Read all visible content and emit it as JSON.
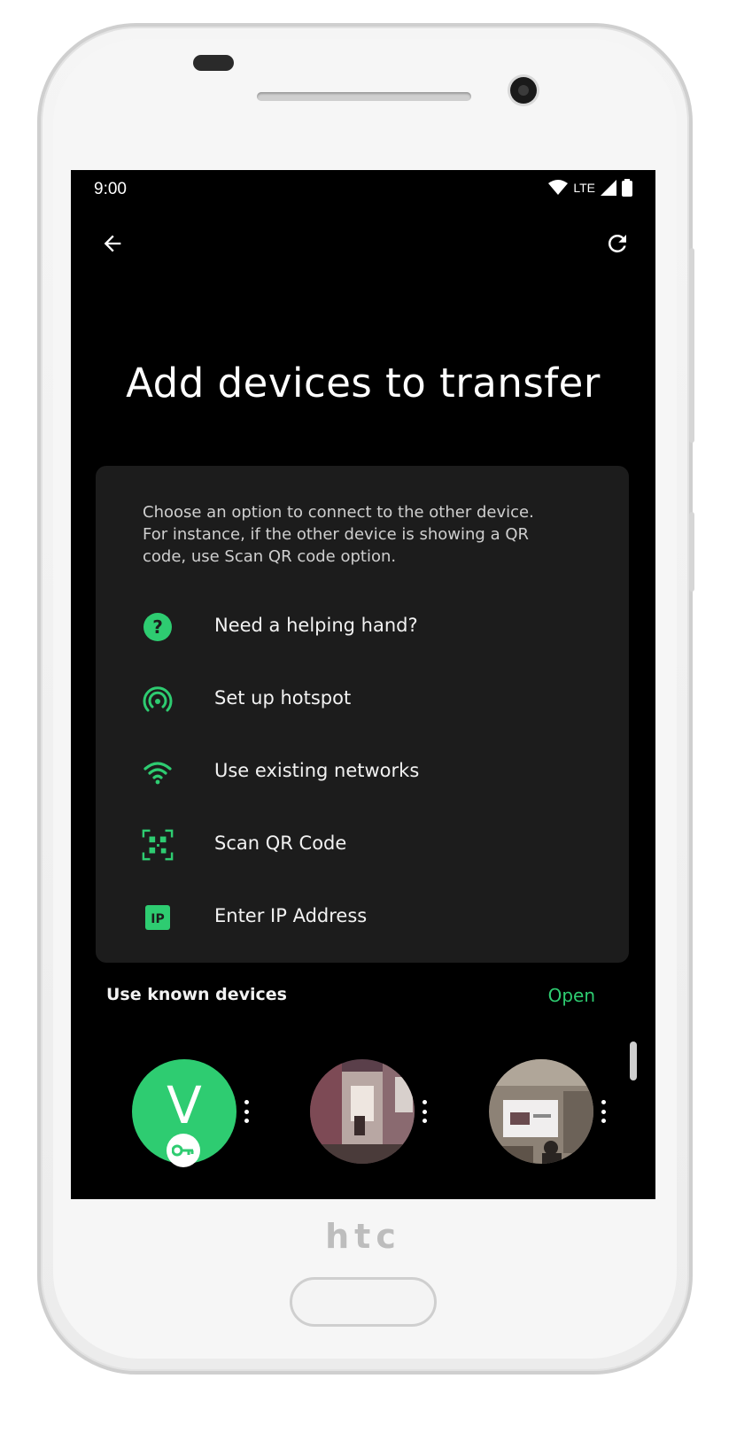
{
  "device_frame": {
    "brand": "htc"
  },
  "status_bar": {
    "time": "9:00",
    "network": "LTE"
  },
  "app_bar": {
    "back_icon": "arrow-left-icon",
    "refresh_icon": "refresh-icon"
  },
  "title": "Add devices to transfer",
  "options_card": {
    "intro_lines": [
      "Choose an option to connect to the other device.",
      "For instance, if the other device is showing a QR",
      "code, use Scan QR code option."
    ],
    "options": [
      {
        "label": "Need a helping hand?",
        "icon": "help-circle-icon"
      },
      {
        "label": "Set up hotspot",
        "icon": "hotspot-icon"
      },
      {
        "label": "Use existing networks",
        "icon": "wifi-icon"
      },
      {
        "label": "Scan QR Code",
        "icon": "qr-scan-icon"
      },
      {
        "label": "Enter IP Address",
        "icon": "ip-icon"
      }
    ]
  },
  "known_devices": {
    "label": "Use known devices",
    "open_label": "Open",
    "devices": [
      {
        "avatar_letter": "V",
        "badge_icon": "key-icon"
      },
      {
        "avatar": "photo-doorway"
      },
      {
        "avatar": "photo-presentation"
      }
    ]
  },
  "colors": {
    "accent": "#2ecc71",
    "background": "#000000",
    "card": "#1c1c1c"
  }
}
